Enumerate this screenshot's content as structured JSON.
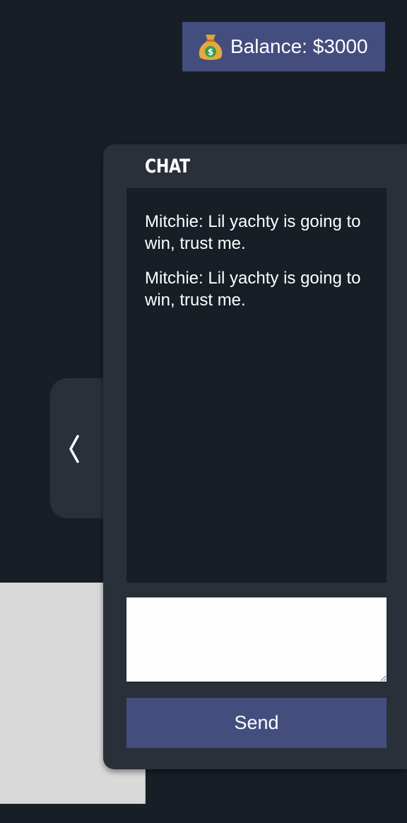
{
  "balance": {
    "icon": "money-bag-icon",
    "label": "Balance: $3000"
  },
  "sidebar_toggle": {
    "icon": "chevron-left-icon"
  },
  "chat": {
    "title": "CHAT",
    "messages": [
      {
        "text": "Mitchie: Lil yachty is going to win, trust me."
      },
      {
        "text": "Mitchie: Lil yachty is going to win, trust me."
      }
    ],
    "input_value": "",
    "send_label": "Send"
  },
  "colors": {
    "background": "#181e26",
    "panel": "#29303a",
    "accent": "#434e7f",
    "light_panel": "#d9d9d9"
  }
}
